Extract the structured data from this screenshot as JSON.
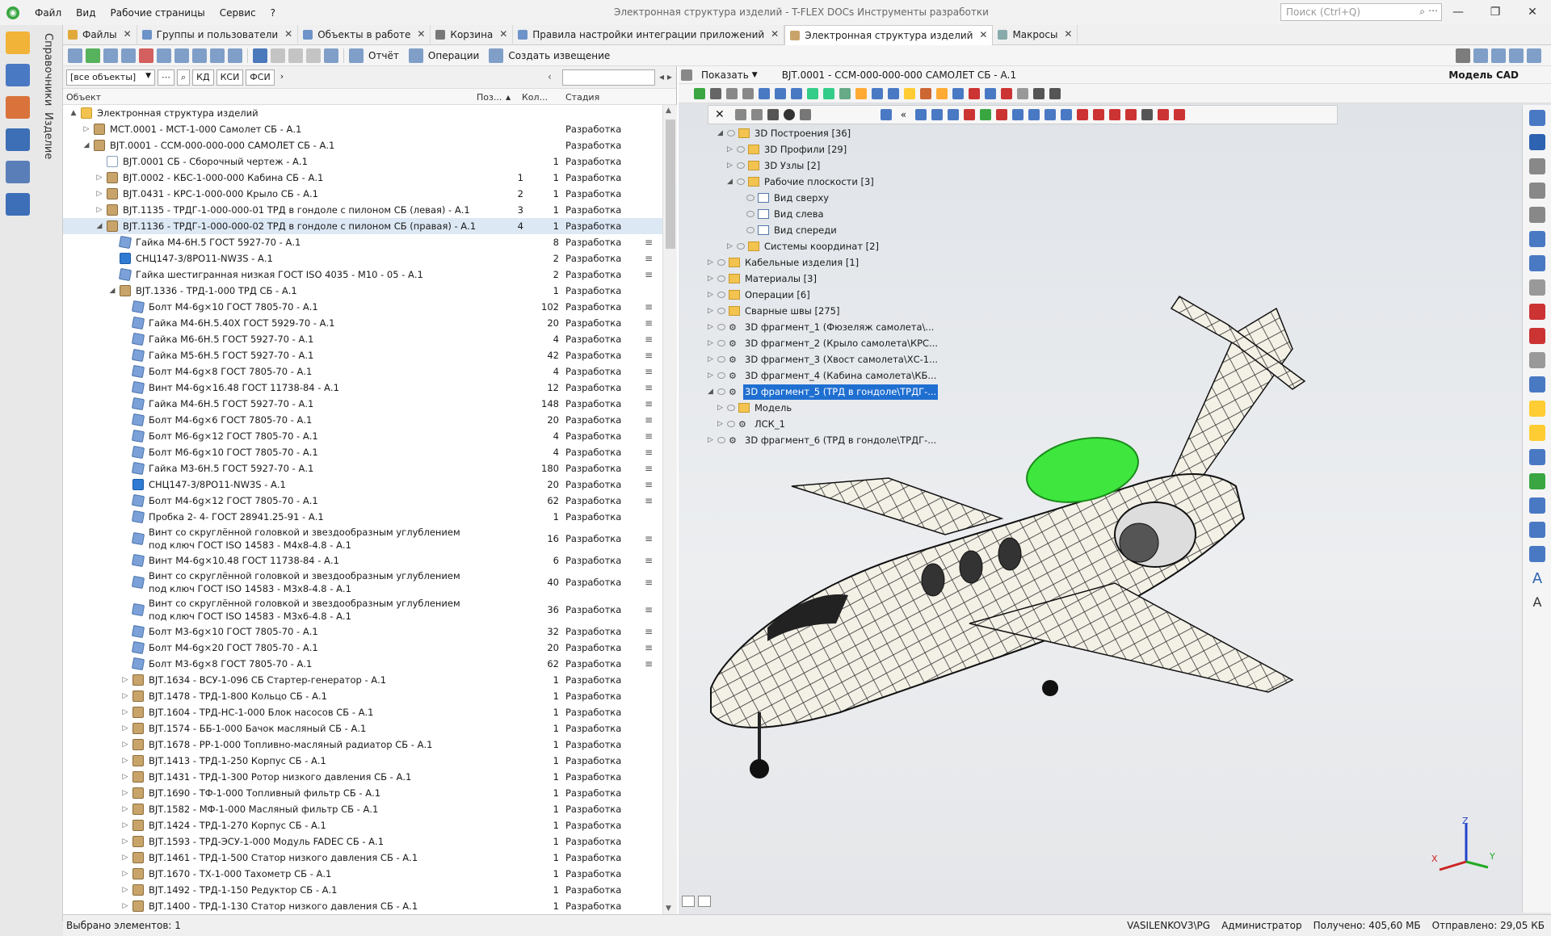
{
  "window": {
    "title": "Электронная структура изделий - T-FLEX DOCs Инструменты разработки",
    "search_placeholder": "Поиск (Ctrl+Q)",
    "menu": [
      "Файл",
      "Вид",
      "Рабочие страницы",
      "Сервис",
      "?"
    ]
  },
  "left_sidebar": {
    "vertical_labels": [
      "Справочники",
      "Изделие"
    ],
    "icons": [
      "mail-icon",
      "structure-icon",
      "library-icon",
      "users-icon",
      "list-icon",
      "home-icon"
    ]
  },
  "tabs": [
    {
      "label": "Файлы",
      "active": false
    },
    {
      "label": "Группы и пользователи",
      "active": false
    },
    {
      "label": "Объекты в работе",
      "active": false
    },
    {
      "label": "Корзина",
      "active": false
    },
    {
      "label": "Правила настройки интеграции приложений",
      "active": false
    },
    {
      "label": "Электронная структура изделий",
      "active": true
    },
    {
      "label": "Макросы",
      "active": false
    }
  ],
  "toolbar": {
    "report_label": "Отчёт",
    "operations_label": "Операции",
    "create_notice_label": "Создать извещение"
  },
  "filter": {
    "combo_value": "[все объекты]",
    "buttons": [
      "КД",
      "КСИ",
      "ФСИ"
    ]
  },
  "columns": {
    "object": "Объект",
    "pos": "Поз...",
    "qty": "Кол...",
    "stage": "Стадия"
  },
  "rows": [
    {
      "level": 0,
      "exp": "▲",
      "icon": "folder",
      "name": "Электронная структура изделий",
      "pos": "",
      "qty": "",
      "stage": "",
      "menu": false
    },
    {
      "level": 1,
      "exp": "▷",
      "icon": "asm",
      "name": "МСТ.0001 - МСТ-1-000 Самолет СБ - А.1",
      "pos": "",
      "qty": "",
      "stage": "Разработка",
      "menu": false
    },
    {
      "level": 1,
      "exp": "◢",
      "icon": "asm",
      "name": "ВJТ.0001 - ССМ-000-000-000 САМОЛЕТ СБ - А.1",
      "pos": "",
      "qty": "",
      "stage": "Разработка",
      "menu": false
    },
    {
      "level": 2,
      "exp": "",
      "icon": "doc",
      "name": "ВJТ.0001 СБ - Сборочный чертеж - А.1",
      "pos": "",
      "qty": "1",
      "stage": "Разработка",
      "menu": false
    },
    {
      "level": 2,
      "exp": "▷",
      "icon": "asm",
      "name": "ВJТ.0002 - КБС-1-000-000 Кабина СБ - А.1",
      "pos": "1",
      "qty": "1",
      "stage": "Разработка",
      "menu": false
    },
    {
      "level": 2,
      "exp": "▷",
      "icon": "asm",
      "name": "ВJТ.0431 - КРС-1-000-000 Крыло СБ - А.1",
      "pos": "2",
      "qty": "1",
      "stage": "Разработка",
      "menu": false
    },
    {
      "level": 2,
      "exp": "▷",
      "icon": "asm",
      "name": "ВJТ.1135 - ТРДГ-1-000-000-01 ТРД в гондоле с пилоном СБ (левая) - А.1",
      "pos": "3",
      "qty": "1",
      "stage": "Разработка",
      "menu": false
    },
    {
      "level": 2,
      "exp": "◢",
      "icon": "asm",
      "name": "ВJТ.1136 - ТРДГ-1-000-000-02 ТРД в гондоле с пилоном СБ (правая) - А.1",
      "pos": "4",
      "qty": "1",
      "stage": "Разработка",
      "menu": false,
      "selected": true
    },
    {
      "level": 3,
      "exp": "",
      "icon": "std",
      "name": "Гайка М4-6Н.5 ГОСТ 5927-70 - А.1",
      "pos": "",
      "qty": "8",
      "stage": "Разработка",
      "menu": true
    },
    {
      "level": 3,
      "exp": "",
      "icon": "mat",
      "name": "СНЦ147-3/8РО11-NW3S - А.1",
      "pos": "",
      "qty": "2",
      "stage": "Разработка",
      "menu": true
    },
    {
      "level": 3,
      "exp": "",
      "icon": "std",
      "name": "Гайка шестигранная низкая ГОСТ ISO 4035 - M10 - 05 - А.1",
      "pos": "",
      "qty": "2",
      "stage": "Разработка",
      "menu": true
    },
    {
      "level": 3,
      "exp": "◢",
      "icon": "asm",
      "name": "ВJТ.1336 - ТРД-1-000 ТРД СБ - А.1",
      "pos": "",
      "qty": "1",
      "stage": "Разработка",
      "menu": false
    },
    {
      "level": 4,
      "exp": "",
      "icon": "std",
      "name": "Болт М4-6g×10 ГОСТ 7805-70 - А.1",
      "pos": "",
      "qty": "102",
      "stage": "Разработка",
      "menu": true
    },
    {
      "level": 4,
      "exp": "",
      "icon": "std",
      "name": "Гайка М4-6Н.5.40Х ГОСТ 5929-70 - А.1",
      "pos": "",
      "qty": "20",
      "stage": "Разработка",
      "menu": true
    },
    {
      "level": 4,
      "exp": "",
      "icon": "std",
      "name": "Гайка М6-6Н.5 ГОСТ 5927-70 - А.1",
      "pos": "",
      "qty": "4",
      "stage": "Разработка",
      "menu": true
    },
    {
      "level": 4,
      "exp": "",
      "icon": "std",
      "name": "Гайка М5-6Н.5 ГОСТ 5927-70 - А.1",
      "pos": "",
      "qty": "42",
      "stage": "Разработка",
      "menu": true
    },
    {
      "level": 4,
      "exp": "",
      "icon": "std",
      "name": "Болт М4-6g×8 ГОСТ 7805-70 - А.1",
      "pos": "",
      "qty": "4",
      "stage": "Разработка",
      "menu": true
    },
    {
      "level": 4,
      "exp": "",
      "icon": "std",
      "name": "Винт М4-6g×16.48 ГОСТ 11738-84 - А.1",
      "pos": "",
      "qty": "12",
      "stage": "Разработка",
      "menu": true
    },
    {
      "level": 4,
      "exp": "",
      "icon": "std",
      "name": "Гайка М4-6Н.5 ГОСТ 5927-70 - А.1",
      "pos": "",
      "qty": "148",
      "stage": "Разработка",
      "menu": true
    },
    {
      "level": 4,
      "exp": "",
      "icon": "std",
      "name": "Болт М4-6g×6 ГОСТ 7805-70 - А.1",
      "pos": "",
      "qty": "20",
      "stage": "Разработка",
      "menu": true
    },
    {
      "level": 4,
      "exp": "",
      "icon": "std",
      "name": "Болт М6-6g×12 ГОСТ 7805-70 - А.1",
      "pos": "",
      "qty": "4",
      "stage": "Разработка",
      "menu": true
    },
    {
      "level": 4,
      "exp": "",
      "icon": "std",
      "name": "Болт М6-6g×10 ГОСТ 7805-70 - А.1",
      "pos": "",
      "qty": "4",
      "stage": "Разработка",
      "menu": true
    },
    {
      "level": 4,
      "exp": "",
      "icon": "std",
      "name": "Гайка М3-6Н.5 ГОСТ 5927-70 - А.1",
      "pos": "",
      "qty": "180",
      "stage": "Разработка",
      "menu": true
    },
    {
      "level": 4,
      "exp": "",
      "icon": "mat",
      "name": "СНЦ147-3/8РО11-NW3S - А.1",
      "pos": "",
      "qty": "20",
      "stage": "Разработка",
      "menu": true
    },
    {
      "level": 4,
      "exp": "",
      "icon": "std",
      "name": "Болт М4-6g×12 ГОСТ 7805-70 - А.1",
      "pos": "",
      "qty": "62",
      "stage": "Разработка",
      "menu": true
    },
    {
      "level": 4,
      "exp": "",
      "icon": "std",
      "name": "Пробка 2- 4- ГОСТ 28941.25-91 - А.1",
      "pos": "",
      "qty": "1",
      "stage": "Разработка",
      "menu": false
    },
    {
      "level": 4,
      "exp": "",
      "icon": "std",
      "name": "Винт со скруглённой головкой и звездообразным углублением под ключ ГОСТ ISO 14583 - М4х8-4.8 - А.1",
      "pos": "",
      "qty": "16",
      "stage": "Разработка",
      "menu": true,
      "wrap": true
    },
    {
      "level": 4,
      "exp": "",
      "icon": "std",
      "name": "Винт М4-6g×10.48 ГОСТ 11738-84 - А.1",
      "pos": "",
      "qty": "6",
      "stage": "Разработка",
      "menu": true
    },
    {
      "level": 4,
      "exp": "",
      "icon": "std",
      "name": "Винт со скруглённой головкой и звездообразным углублением под ключ ГОСТ ISO 14583 - М3х8-4.8 - А.1",
      "pos": "",
      "qty": "40",
      "stage": "Разработка",
      "menu": true,
      "wrap": true
    },
    {
      "level": 4,
      "exp": "",
      "icon": "std",
      "name": "Винт со скруглённой головкой и звездообразным углублением под ключ ГОСТ ISO 14583 - М3х6-4.8 - А.1",
      "pos": "",
      "qty": "36",
      "stage": "Разработка",
      "menu": true,
      "wrap": true
    },
    {
      "level": 4,
      "exp": "",
      "icon": "std",
      "name": "Болт М3-6g×10 ГОСТ 7805-70 - А.1",
      "pos": "",
      "qty": "32",
      "stage": "Разработка",
      "menu": true
    },
    {
      "level": 4,
      "exp": "",
      "icon": "std",
      "name": "Болт М4-6g×20 ГОСТ 7805-70 - А.1",
      "pos": "",
      "qty": "20",
      "stage": "Разработка",
      "menu": true
    },
    {
      "level": 4,
      "exp": "",
      "icon": "std",
      "name": "Болт М3-6g×8 ГОСТ 7805-70 - А.1",
      "pos": "",
      "qty": "62",
      "stage": "Разработка",
      "menu": true
    },
    {
      "level": 4,
      "exp": "▷",
      "icon": "asm",
      "name": "ВJТ.1634 - ВСУ-1-096 СБ Стартер-генератор - А.1",
      "pos": "",
      "qty": "1",
      "stage": "Разработка",
      "menu": false
    },
    {
      "level": 4,
      "exp": "▷",
      "icon": "asm",
      "name": "ВJТ.1478 - ТРД-1-800 Кольцо СБ - А.1",
      "pos": "",
      "qty": "1",
      "stage": "Разработка",
      "menu": false
    },
    {
      "level": 4,
      "exp": "▷",
      "icon": "asm",
      "name": "ВJТ.1604 - ТРД-НС-1-000 Блок насосов СБ - А.1",
      "pos": "",
      "qty": "1",
      "stage": "Разработка",
      "menu": false
    },
    {
      "level": 4,
      "exp": "▷",
      "icon": "asm",
      "name": "ВJТ.1574 - ББ-1-000 Бачок масляный СБ - А.1",
      "pos": "",
      "qty": "1",
      "stage": "Разработка",
      "menu": false
    },
    {
      "level": 4,
      "exp": "▷",
      "icon": "asm",
      "name": "ВJТ.1678 - РР-1-000 Топливно-масляный радиатор СБ - А.1",
      "pos": "",
      "qty": "1",
      "stage": "Разработка",
      "menu": false
    },
    {
      "level": 4,
      "exp": "▷",
      "icon": "asm",
      "name": "ВJТ.1413 - ТРД-1-250 Корпус СБ - А.1",
      "pos": "",
      "qty": "1",
      "stage": "Разработка",
      "menu": false
    },
    {
      "level": 4,
      "exp": "▷",
      "icon": "asm",
      "name": "ВJТ.1431 - ТРД-1-300 Ротор низкого давления СБ - А.1",
      "pos": "",
      "qty": "1",
      "stage": "Разработка",
      "menu": false
    },
    {
      "level": 4,
      "exp": "▷",
      "icon": "asm",
      "name": "ВJТ.1690 - ТФ-1-000 Топливный фильтр СБ - А.1",
      "pos": "",
      "qty": "1",
      "stage": "Разработка",
      "menu": false
    },
    {
      "level": 4,
      "exp": "▷",
      "icon": "asm",
      "name": "ВJТ.1582 - МФ-1-000 Масляный фильтр СБ - А.1",
      "pos": "",
      "qty": "1",
      "stage": "Разработка",
      "menu": false
    },
    {
      "level": 4,
      "exp": "▷",
      "icon": "asm",
      "name": "ВJТ.1424 - ТРД-1-270 Корпус СБ - А.1",
      "pos": "",
      "qty": "1",
      "stage": "Разработка",
      "menu": false
    },
    {
      "level": 4,
      "exp": "▷",
      "icon": "asm",
      "name": "ВJТ.1593 - ТРД-ЭСУ-1-000 Модуль FADEC СБ - А.1",
      "pos": "",
      "qty": "1",
      "stage": "Разработка",
      "menu": false
    },
    {
      "level": 4,
      "exp": "▷",
      "icon": "asm",
      "name": "ВJТ.1461 - ТРД-1-500 Статор низкого давления СБ - А.1",
      "pos": "",
      "qty": "1",
      "stage": "Разработка",
      "menu": false
    },
    {
      "level": 4,
      "exp": "▷",
      "icon": "asm",
      "name": "ВJТ.1670 - ТХ-1-000 Тахометр СБ - А.1",
      "pos": "",
      "qty": "1",
      "stage": "Разработка",
      "menu": false
    },
    {
      "level": 4,
      "exp": "▷",
      "icon": "asm",
      "name": "ВJТ.1492 - ТРД-1-150 Редуктор СБ - А.1",
      "pos": "",
      "qty": "1",
      "stage": "Разработка",
      "menu": false
    },
    {
      "level": 4,
      "exp": "▷",
      "icon": "asm",
      "name": "ВJТ.1400 - ТРД-1-130 Статор низкого давления СБ - А.1",
      "pos": "",
      "qty": "1",
      "stage": "Разработка",
      "menu": false
    }
  ],
  "right": {
    "show_label": "Показать",
    "path": "ВJТ.0001 - ССМ-000-000-000 САМОЛЕТ СБ - А.1",
    "model_label": "Модель CAD",
    "tree": [
      {
        "indent": 1,
        "exp": "◢",
        "type": "folder",
        "label": "3D Построения [36]"
      },
      {
        "indent": 2,
        "exp": "▷",
        "type": "folder",
        "label": "3D Профили [29]"
      },
      {
        "indent": 2,
        "exp": "▷",
        "type": "folder",
        "label": "3D Узлы [2]"
      },
      {
        "indent": 2,
        "exp": "◢",
        "type": "folder",
        "label": "Рабочие плоскости [3]"
      },
      {
        "indent": 3,
        "exp": "",
        "type": "plane",
        "label": "Вид сверху"
      },
      {
        "indent": 3,
        "exp": "",
        "type": "plane",
        "label": "Вид слева"
      },
      {
        "indent": 3,
        "exp": "",
        "type": "plane",
        "label": "Вид спереди"
      },
      {
        "indent": 2,
        "exp": "▷",
        "type": "folder",
        "label": "Системы координат [2]"
      },
      {
        "indent": 0,
        "exp": "▷",
        "type": "folder",
        "label": "Кабельные изделия [1]"
      },
      {
        "indent": 0,
        "exp": "▷",
        "type": "folder",
        "label": "Материалы [3]"
      },
      {
        "indent": 0,
        "exp": "▷",
        "type": "folder",
        "label": "Операции [6]"
      },
      {
        "indent": 0,
        "exp": "▷",
        "type": "folder",
        "label": "Сварные швы [275]"
      },
      {
        "indent": 0,
        "exp": "▷",
        "type": "frag",
        "label": "3D фрагмент_1 (Фюзеляж самолета\\..."
      },
      {
        "indent": 0,
        "exp": "▷",
        "type": "frag",
        "label": "3D фрагмент_2 (Крыло самолета\\КРС..."
      },
      {
        "indent": 0,
        "exp": "▷",
        "type": "frag",
        "label": "3D фрагмент_3 (Хвост самолета\\ХС-1..."
      },
      {
        "indent": 0,
        "exp": "▷",
        "type": "frag",
        "label": "3D фрагмент_4 (Кабина самолета\\КБ..."
      },
      {
        "indent": 0,
        "exp": "◢",
        "type": "frag",
        "label": "3D фрагмент_5 (ТРД в гондоле\\ТРДГ-...",
        "highlight": true
      },
      {
        "indent": 1,
        "exp": "▷",
        "type": "folder",
        "label": "Модель"
      },
      {
        "indent": 1,
        "exp": "▷",
        "type": "frag",
        "label": "ЛСК_1"
      },
      {
        "indent": 0,
        "exp": "▷",
        "type": "frag",
        "label": "3D фрагмент_6 (ТРД в гондоле\\ТРДГ-..."
      }
    ],
    "axes": {
      "x": "X",
      "y": "Y",
      "z": "Z"
    }
  },
  "status": {
    "selected": "Выбрано элементов: 1",
    "user": "VASILENKOV3\\PG",
    "role": "Администратор",
    "received": "Получено: 405,60 МБ",
    "sent": "Отправлено: 29,05 КБ"
  },
  "colors": {
    "highlight": "#1f6fd1",
    "engine_selected": "#3ee63e",
    "selected_row": "#dde8f5"
  }
}
